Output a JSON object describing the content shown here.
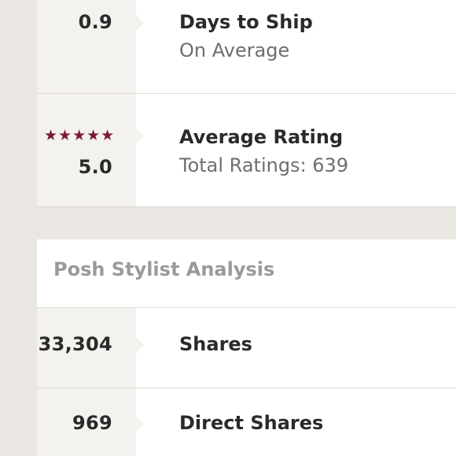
{
  "seller_stats": {
    "ship": {
      "value": "0.9",
      "title": "Days to Ship",
      "subtitle": "On Average"
    },
    "rating": {
      "stars": "★★★★★",
      "star_count": 5,
      "value": "5.0",
      "title": "Average Rating",
      "subtitle": "Total Ratings: 639"
    }
  },
  "stylist_analysis": {
    "title": "Posh Stylist Analysis",
    "rows": [
      {
        "value": "33,304",
        "label": "Shares"
      },
      {
        "value": "969",
        "label": "Direct Shares"
      }
    ]
  },
  "colors": {
    "page_background": "#eae7e2",
    "card_background": "#ffffff",
    "stat_column": "#f4f2ee",
    "star": "#7a1d34",
    "divider": "#dedbd6"
  }
}
